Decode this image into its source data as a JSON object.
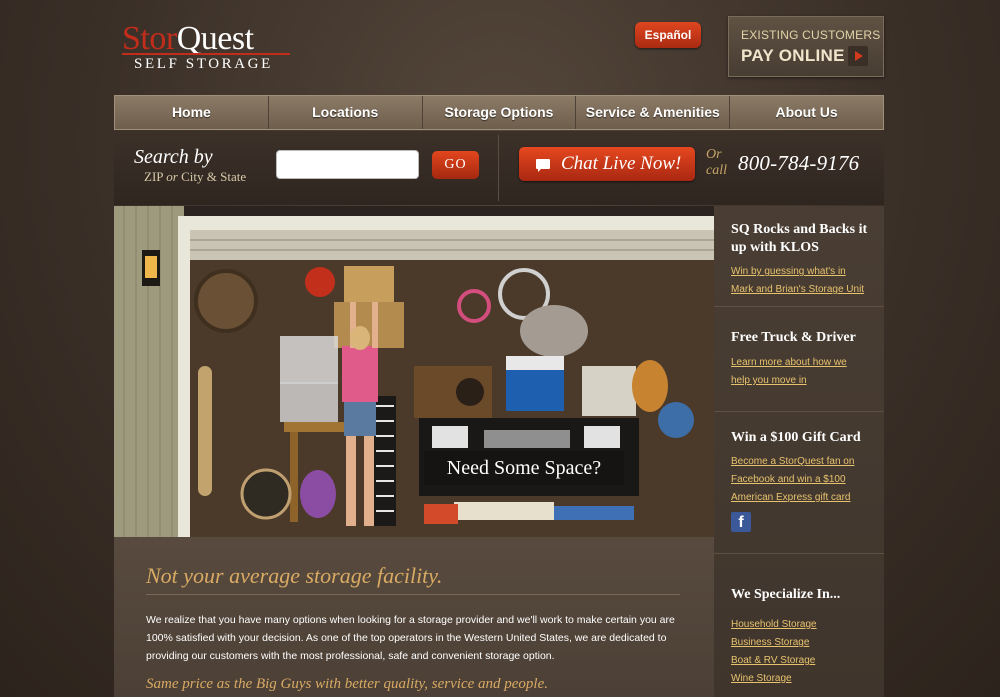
{
  "header": {
    "logo_brand_a": "Stor",
    "logo_brand_b": "Quest",
    "logo_sub": "SELF STORAGE",
    "espanol": "Español",
    "pay_line1": "EXISTING CUSTOMERS",
    "pay_line2": "PAY ONLINE"
  },
  "nav": {
    "items": [
      {
        "label": "Home"
      },
      {
        "label": "Locations"
      },
      {
        "label": "Storage Options"
      },
      {
        "label": "Service & Amenities"
      },
      {
        "label": "About Us"
      }
    ]
  },
  "search": {
    "title": "Search by",
    "sub_a": "ZIP",
    "sub_or": "or",
    "sub_b": "City & State",
    "input_value": "",
    "go_label": "GO"
  },
  "contact": {
    "chat_label": "Chat Live Now!",
    "or_line1": "Or",
    "or_line2": "call",
    "phone": "800-784-9176"
  },
  "hero": {
    "caption": "Need Some Space?"
  },
  "content": {
    "heading": "Not your average storage facility.",
    "body": "We realize that you have many options when looking for a storage provider and we'll work to make certain you are 100% satisfied with your decision. As one of the top operators in the Western United States, we are dedicated to providing our customers with the most professional, safe and convenient storage option.",
    "tagline": "Same price as the Big Guys with better quality, service and people."
  },
  "sidebar": {
    "s1_title": "SQ Rocks and Backs it up with KLOS",
    "s1_link1": "Win by guessing what's in",
    "s1_link2": "Mark and Brian's Storage Unit",
    "s2_title": "Free Truck & Driver",
    "s2_link1": "Learn more about how we",
    "s2_link2": "help you move in",
    "s3_title": "Win a $100 Gift Card",
    "s3_link1": "Become a StorQuest fan on",
    "s3_link2": "Facebook and win a $100",
    "s3_link3": "American Express gift card",
    "fb_glyph": "f",
    "s4_title": "We Specialize In...",
    "s4_items": [
      "Household Storage",
      "Business Storage",
      "Boat & RV Storage",
      "Wine Storage"
    ]
  },
  "colors": {
    "accent_red": "#c22d1b",
    "gold_text": "#d9aa63",
    "link_gold": "#e7c26e"
  }
}
